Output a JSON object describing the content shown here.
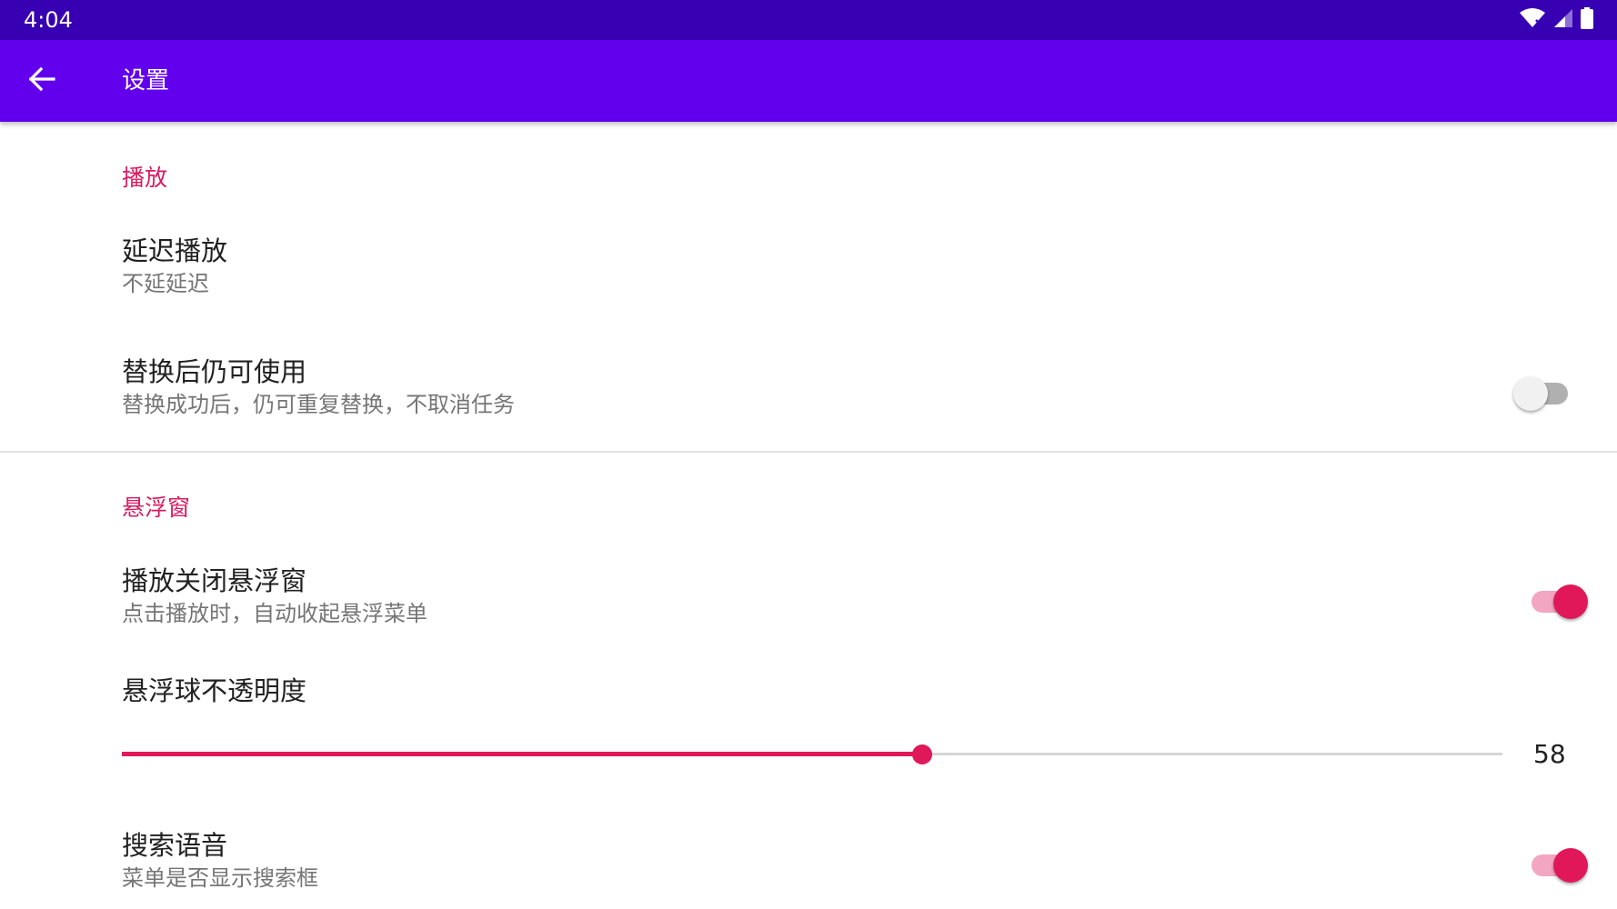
{
  "status_bar": {
    "time": "4:04",
    "icons": [
      "wifi-icon",
      "signal-icon",
      "battery-icon"
    ]
  },
  "app_bar": {
    "title": "设置",
    "back_icon": "arrow-left-icon"
  },
  "sections": {
    "playback": {
      "header": "播放",
      "delay": {
        "title": "延迟播放",
        "summary": "不延延迟"
      },
      "reuse_after_replace": {
        "title": "替换后仍可使用",
        "summary": "替换成功后，仍可重复替换，不取消任务",
        "checked": false
      }
    },
    "floating": {
      "header": "悬浮窗",
      "close_on_play": {
        "title": "播放关闭悬浮窗",
        "summary": "点击播放时，自动收起悬浮菜单",
        "checked": true
      },
      "ball_opacity": {
        "title": "悬浮球不透明度",
        "value": 58,
        "value_text": "58",
        "max": 100
      },
      "search_voice": {
        "title": "搜索语音",
        "summary": "菜单是否显示搜索框",
        "checked": true
      }
    }
  },
  "colors": {
    "status_bar": "#3700b3",
    "app_bar": "#6200ee",
    "accent": "#e0185a",
    "category_text": "#d81b60"
  }
}
